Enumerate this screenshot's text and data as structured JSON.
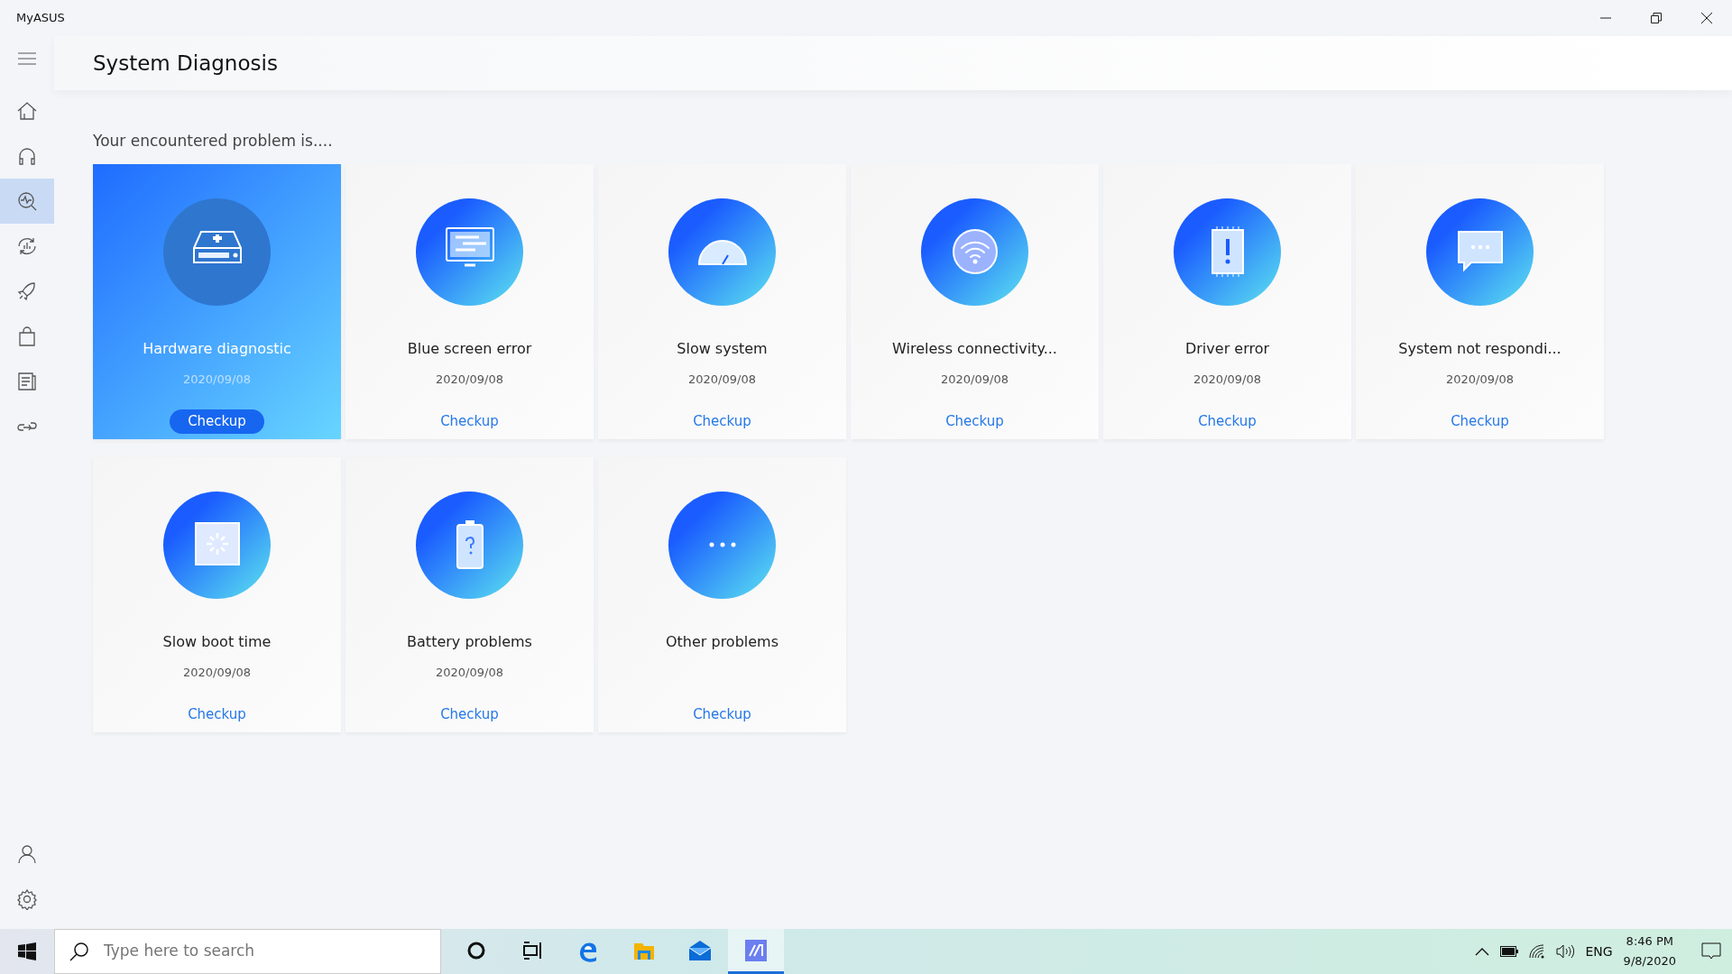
{
  "window": {
    "title": "MyASUS"
  },
  "header": {
    "title": "System Diagnosis"
  },
  "sidebar": {
    "items": [
      {
        "kind": "home",
        "selected": false
      },
      {
        "kind": "headset",
        "selected": false
      },
      {
        "kind": "diagnosis",
        "selected": true
      },
      {
        "kind": "optimize",
        "selected": false
      },
      {
        "kind": "rocket",
        "selected": false
      },
      {
        "kind": "bag",
        "selected": false
      },
      {
        "kind": "news",
        "selected": false
      },
      {
        "kind": "link",
        "selected": false
      }
    ],
    "bottom_items": [
      {
        "kind": "user",
        "selected": false
      },
      {
        "kind": "settings",
        "selected": false
      }
    ]
  },
  "prompt": "Your encountered problem is....",
  "cards": [
    {
      "kind": "drive",
      "title": "Hardware diagnostic",
      "date": "2020/09/08",
      "action": "Checkup",
      "selected": true
    },
    {
      "kind": "monitor",
      "title": "Blue screen error",
      "date": "2020/09/08",
      "action": "Checkup",
      "selected": false
    },
    {
      "kind": "gauge",
      "title": "Slow system",
      "date": "2020/09/08",
      "action": "Checkup",
      "selected": false
    },
    {
      "kind": "wifi",
      "title": "Wireless connectivity...",
      "date": "2020/09/08",
      "action": "Checkup",
      "selected": false
    },
    {
      "kind": "chip",
      "title": "Driver error",
      "date": "2020/09/08",
      "action": "Checkup",
      "selected": false
    },
    {
      "kind": "chat",
      "title": "System not respondi...",
      "date": "2020/09/08",
      "action": "Checkup",
      "selected": false
    },
    {
      "kind": "boot",
      "title": "Slow boot time",
      "date": "2020/09/08",
      "action": "Checkup",
      "selected": false
    },
    {
      "kind": "battery",
      "title": "Battery problems",
      "date": "2020/09/08",
      "action": "Checkup",
      "selected": false
    },
    {
      "kind": "dots",
      "title": "Other problems",
      "action": "Checkup",
      "selected": false
    }
  ],
  "taskbar": {
    "search_placeholder": "Type here to search",
    "apps": [
      {
        "kind": "cortana",
        "selected": false
      },
      {
        "kind": "taskview",
        "selected": false
      },
      {
        "kind": "edge",
        "selected": false
      },
      {
        "kind": "folder",
        "selected": false
      },
      {
        "kind": "mail",
        "selected": false
      },
      {
        "kind": "myasus",
        "selected": true
      }
    ],
    "language": "ENG",
    "time": "8:46 PM",
    "date": "9/8/2020"
  }
}
